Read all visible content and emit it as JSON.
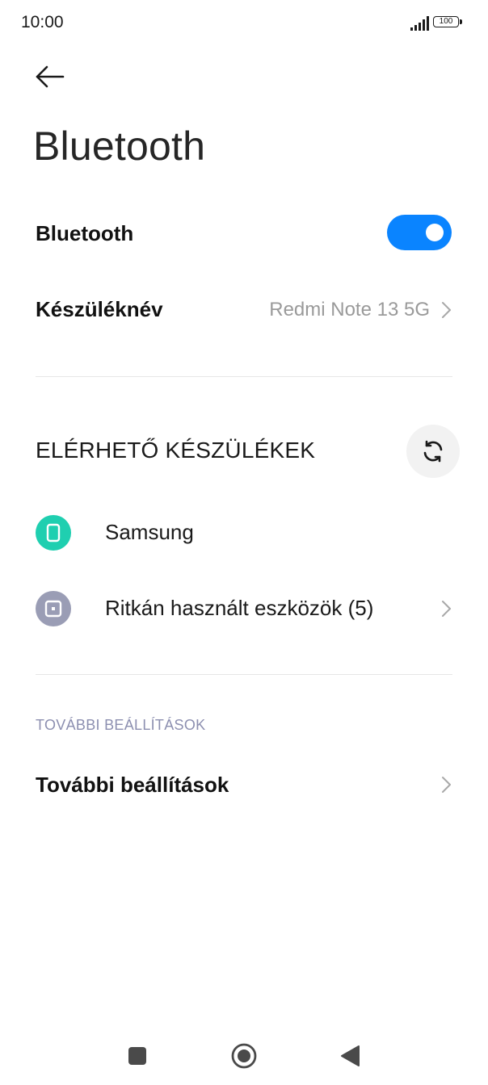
{
  "status_bar": {
    "time": "10:00",
    "battery": "100",
    "icons": [
      "signal-icon",
      "battery-icon"
    ]
  },
  "header": {
    "back_icon": "arrow-left-icon",
    "title": "Bluetooth"
  },
  "bluetooth_toggle": {
    "label": "Bluetooth",
    "state": "on",
    "accent_color": "#0a84ff"
  },
  "device_name": {
    "label": "Készüléknév",
    "value": "Redmi Note 13 5G",
    "icon": "chevron-right-icon"
  },
  "available_devices": {
    "heading": "ELÉRHETŐ KÉSZÜLÉKEK",
    "refresh_icon": "refresh-icon",
    "items": [
      {
        "name": "Samsung",
        "icon": "phone-icon",
        "icon_color": "#1fcfb0",
        "has_chevron": false
      },
      {
        "name": "Ritkán használt eszközök (5)",
        "icon": "device-icon",
        "icon_color": "#9a9db5",
        "has_chevron": true
      }
    ]
  },
  "more_settings": {
    "section_heading": "TOVÁBBI BEÁLLÍTÁSOK",
    "label": "További beállítások",
    "icon": "chevron-right-icon"
  },
  "nav_bar": {
    "items": [
      "recents-icon",
      "home-icon",
      "back-icon"
    ]
  }
}
